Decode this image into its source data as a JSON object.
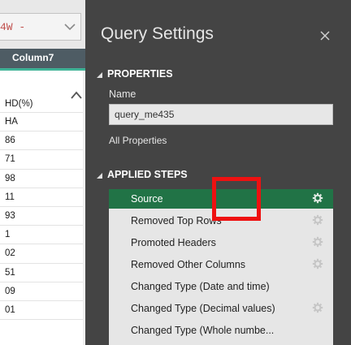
{
  "grid": {
    "combo_text": "4W -",
    "column_header": "Column7",
    "cells": [
      "HD(%)",
      "HA",
      "86",
      "71",
      "98",
      "11",
      "93",
      "1",
      "02",
      "51",
      "09",
      "01"
    ]
  },
  "query_settings": {
    "title": "Query Settings",
    "properties": {
      "heading": "PROPERTIES",
      "name_label": "Name",
      "name_value": "query_me435",
      "all_properties_link": "All Properties"
    },
    "applied_steps": {
      "heading": "APPLIED STEPS",
      "steps": [
        {
          "label": "Source",
          "has_gear": true,
          "selected": true
        },
        {
          "label": "Removed Top Rows",
          "has_gear": true,
          "selected": false
        },
        {
          "label": "Promoted Headers",
          "has_gear": true,
          "selected": false
        },
        {
          "label": "Removed Other Columns",
          "has_gear": true,
          "selected": false
        },
        {
          "label": "Changed Type (Date and time)",
          "has_gear": false,
          "selected": false
        },
        {
          "label": "Changed Type (Decimal values)",
          "has_gear": true,
          "selected": false
        },
        {
          "label": "Changed Type (Whole numbe...",
          "has_gear": false,
          "selected": false
        }
      ]
    }
  },
  "colors": {
    "pane_background": "#444444",
    "selected_step": "#217346",
    "header_accent": "#3fb397",
    "highlight": "#ee1111"
  },
  "icons": [
    "chevron-down-icon",
    "close-icon",
    "gear-icon",
    "triangle-down-icon",
    "scroll-up-arrow-icon"
  ]
}
